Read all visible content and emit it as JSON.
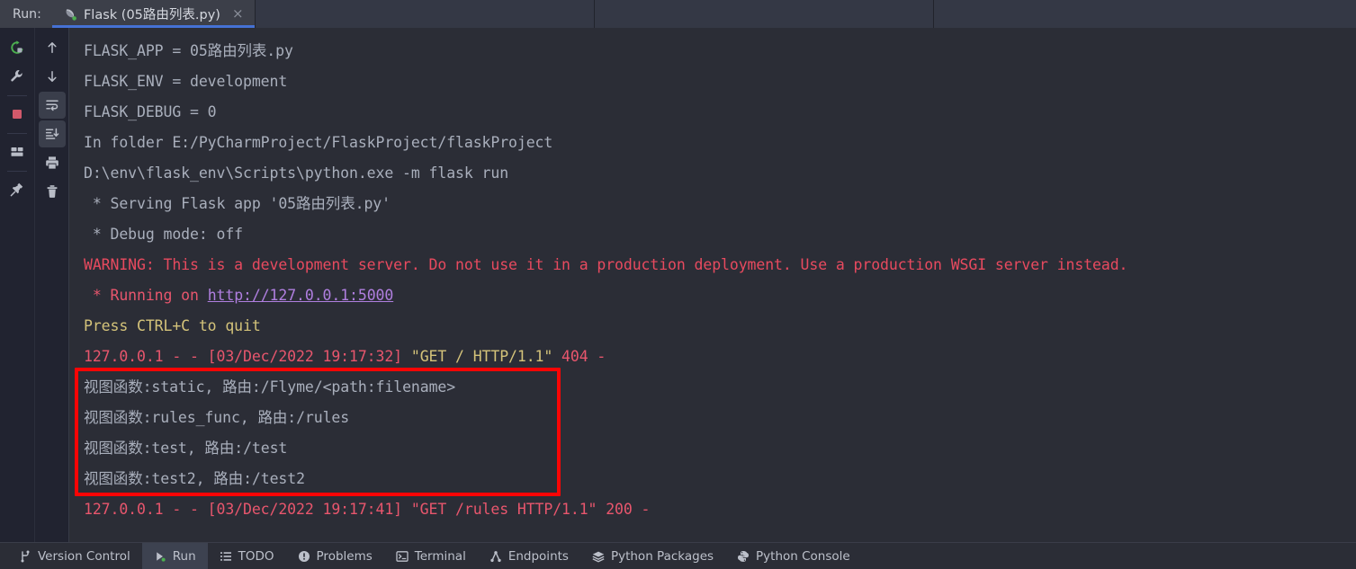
{
  "window": {
    "run_label": "Run:",
    "bg_console": "#2b2d36",
    "bg_toolbar": "#212330",
    "accent_tab_underline": "#4571d4",
    "annotation_color": "#fa0505"
  },
  "run_tab": {
    "title": "Flask (05路由列表.py)",
    "icon": "flask-icon",
    "status_dot_color": "#4caf50",
    "close_glyph": "×",
    "active": true
  },
  "toolbar_left": {
    "items": [
      {
        "name": "rerun-button",
        "icon": "rerun-icon",
        "tooltip": "Rerun"
      },
      {
        "name": "settings-button",
        "icon": "wrench-icon",
        "tooltip": "Modify Run Configuration"
      },
      {
        "name": "stop-button",
        "icon": "stop-square-icon",
        "tooltip": "Stop"
      },
      {
        "name": "layout-button",
        "icon": "layout-icon",
        "tooltip": "Layout Settings"
      },
      {
        "name": "pin-button",
        "icon": "pin-icon",
        "tooltip": "Pin Tab"
      }
    ]
  },
  "toolbar_right": {
    "items": [
      {
        "name": "up-button",
        "icon": "arrow-up-icon",
        "tooltip": "Up the Stack Trace"
      },
      {
        "name": "down-button",
        "icon": "arrow-down-icon",
        "tooltip": "Down the Stack Trace"
      },
      {
        "name": "soft-wrap-button",
        "icon": "soft-wrap-icon",
        "tooltip": "Use Soft Wraps",
        "pressed": true
      },
      {
        "name": "scroll-end-button",
        "icon": "scroll-to-end-icon",
        "tooltip": "Scroll to the End",
        "pressed": true
      },
      {
        "name": "print-button",
        "icon": "printer-icon",
        "tooltip": "Print"
      },
      {
        "name": "clear-button",
        "icon": "trash-icon",
        "tooltip": "Clear All"
      }
    ]
  },
  "console": {
    "lines": [
      {
        "id": "l1",
        "segments": [
          {
            "text": "FLASK_APP = 05路由列表.py",
            "color": "grey"
          }
        ]
      },
      {
        "id": "l2",
        "segments": [
          {
            "text": "FLASK_ENV = development",
            "color": "grey"
          }
        ]
      },
      {
        "id": "l3",
        "segments": [
          {
            "text": "FLASK_DEBUG = 0",
            "color": "grey"
          }
        ]
      },
      {
        "id": "l4",
        "segments": [
          {
            "text": "In folder E:/PyCharmProject/FlaskProject/flaskProject",
            "color": "grey"
          }
        ]
      },
      {
        "id": "l5",
        "segments": [
          {
            "text": "D:\\env\\flask_env\\Scripts\\python.exe -m flask run",
            "color": "grey"
          }
        ]
      },
      {
        "id": "l6",
        "segments": [
          {
            "text": " * Serving Flask app '05路由列表.py'",
            "color": "grey"
          }
        ]
      },
      {
        "id": "l7",
        "segments": [
          {
            "text": " * Debug mode: off",
            "color": "grey"
          }
        ]
      },
      {
        "id": "l8",
        "segments": [
          {
            "text": "WARNING: This is a development server. Do not use it in a production deployment. Use a production WSGI server instead.",
            "color": "red"
          }
        ]
      },
      {
        "id": "l9",
        "segments": [
          {
            "text": " * Running on ",
            "color": "pink"
          },
          {
            "text": "http://127.0.0.1:5000",
            "color": "purple",
            "link": true
          }
        ]
      },
      {
        "id": "l10",
        "segments": [
          {
            "text": "Press CTRL+C to quit",
            "color": "yellow"
          }
        ]
      },
      {
        "id": "l11",
        "segments": [
          {
            "text": "127.0.0.1 - - [03/Dec/2022 19:17:32] ",
            "color": "pink"
          },
          {
            "text": "\"GET / HTTP/1.1\"",
            "color": "yellow"
          },
          {
            "text": " 404 -",
            "color": "pink"
          }
        ]
      },
      {
        "id": "l12",
        "segments": [
          {
            "text": "视图函数:static, 路由:/Flyme/<path:filename>",
            "color": "grey"
          }
        ]
      },
      {
        "id": "l13",
        "segments": [
          {
            "text": "视图函数:rules_func, 路由:/rules",
            "color": "grey"
          }
        ]
      },
      {
        "id": "l14",
        "segments": [
          {
            "text": "视图函数:test, 路由:/test",
            "color": "grey"
          }
        ]
      },
      {
        "id": "l15",
        "segments": [
          {
            "text": "视图函数:test2, 路由:/test2",
            "color": "grey"
          }
        ]
      },
      {
        "id": "l16",
        "segments": [
          {
            "text": "127.0.0.1 - - [03/Dec/2022 19:17:41] \"GET /rules HTTP/1.1\" 200 -",
            "color": "pink"
          }
        ]
      }
    ]
  },
  "statusbar": {
    "items": [
      {
        "label": "Version Control",
        "icon": "branch-icon",
        "name": "status-version-control",
        "active": false
      },
      {
        "label": "Run",
        "icon": "play-icon",
        "name": "status-run",
        "active": true
      },
      {
        "label": "TODO",
        "icon": "list-icon",
        "name": "status-todo",
        "active": false
      },
      {
        "label": "Problems",
        "icon": "warning-circle-icon",
        "name": "status-problems",
        "active": false
      },
      {
        "label": "Terminal",
        "icon": "terminal-icon",
        "name": "status-terminal",
        "active": false
      },
      {
        "label": "Endpoints",
        "icon": "endpoints-icon",
        "name": "status-endpoints",
        "active": false
      },
      {
        "label": "Python Packages",
        "icon": "packages-icon",
        "name": "status-python-packages",
        "active": false
      },
      {
        "label": "Python Console",
        "icon": "python-icon",
        "name": "status-python-console",
        "active": false
      }
    ]
  }
}
